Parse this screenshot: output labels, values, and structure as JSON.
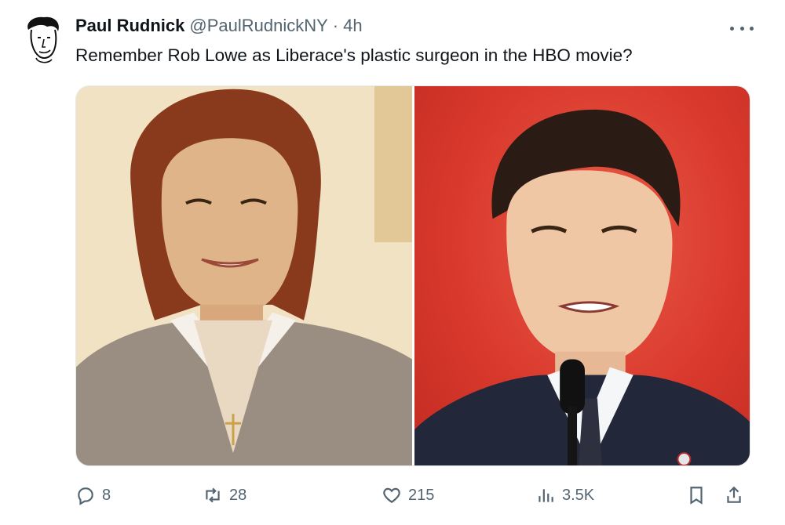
{
  "tweet": {
    "author": {
      "display_name": "Paul Rudnick",
      "handle": "@PaulRudnickNY",
      "separator": "·",
      "time": "4h"
    },
    "text": "Remember Rob Lowe as Liberace's plastic surgeon in the HBO movie?",
    "media": {
      "images": [
        {
          "icon": "photo-left"
        },
        {
          "icon": "photo-right"
        }
      ]
    },
    "actions": {
      "replies": "8",
      "retweets": "28",
      "likes": "215",
      "views": "3.5K"
    }
  },
  "colors": {
    "text_primary": "#0f1419",
    "text_secondary": "#536471",
    "right_photo_bg": "#d9392c"
  }
}
